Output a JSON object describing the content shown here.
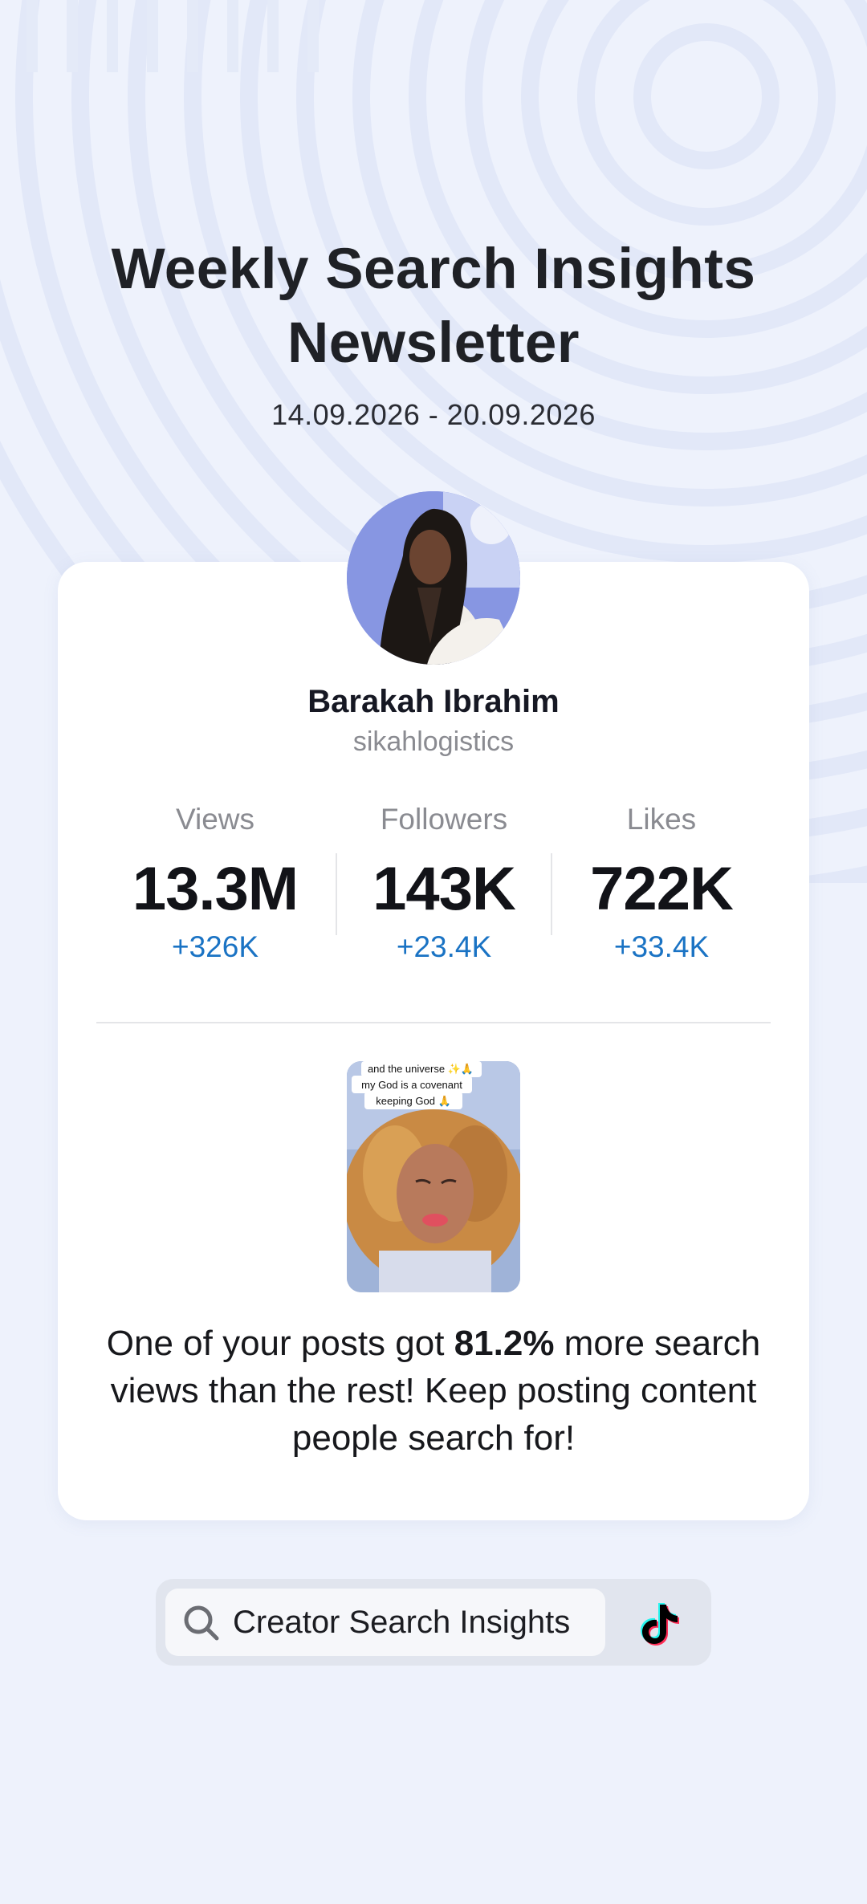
{
  "header": {
    "title": "Weekly Search Insights Newsletter",
    "date_range": "14.09.2026 - 20.09.2026"
  },
  "profile": {
    "name": "Barakah Ibrahim",
    "handle": "sikahlogistics",
    "avatar_icon": "profile-photo"
  },
  "stats": [
    {
      "label": "Views",
      "value": "13.3M",
      "delta": "+326K"
    },
    {
      "label": "Followers",
      "value": "143K",
      "delta": "+23.4K"
    },
    {
      "label": "Likes",
      "value": "722K",
      "delta": "+33.4K"
    }
  ],
  "post": {
    "caption_lines": [
      "and the universe ✨🙏",
      "my God is a covenant",
      "keeping God 🙏"
    ]
  },
  "message": {
    "before": "One of your posts got ",
    "highlight": "81.2%",
    "after": " more search views than the rest! Keep posting content people search for!"
  },
  "search_bar": {
    "label": "Creator Search Insights",
    "icon": "search-icon",
    "brand_icon": "tiktok-icon"
  },
  "colors": {
    "background": "#eef2fc",
    "delta_blue": "#1a73c4",
    "tiktok_cyan": "#25f4ee",
    "tiktok_red": "#fe2c55"
  }
}
